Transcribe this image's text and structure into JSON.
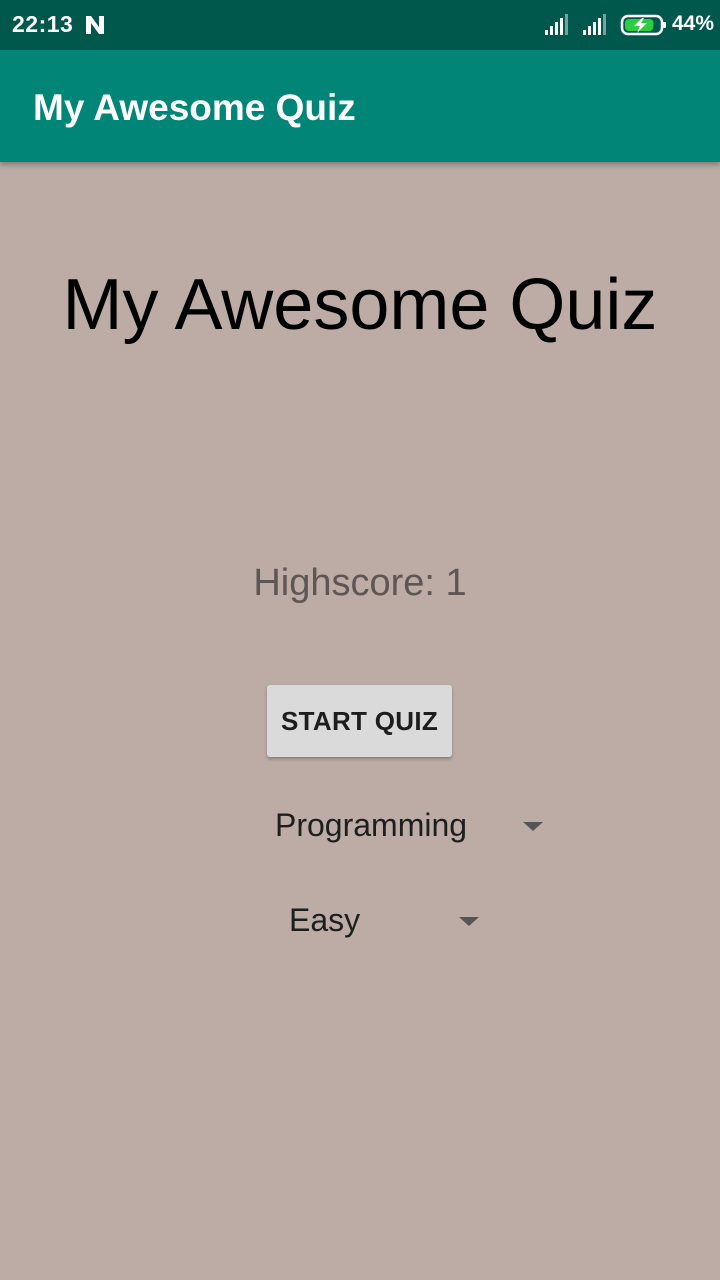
{
  "status_bar": {
    "time": "22:13",
    "battery_percent": "44%",
    "battery_level": 0.44,
    "charging": true,
    "icons": [
      "n-notification-icon",
      "signal-icon",
      "signal-icon",
      "battery-charging-icon"
    ]
  },
  "app_bar": {
    "title": "My Awesome Quiz",
    "color": "#008577"
  },
  "main": {
    "title": "My Awesome Quiz",
    "highscore": "Highscore: 1",
    "start_button_label": "START QUIZ",
    "category_spinner": {
      "selected": "Programming"
    },
    "difficulty_spinner": {
      "selected": "Easy"
    }
  },
  "colors": {
    "status_bar": "#00584c",
    "app_bar": "#008577",
    "background": "#bcaca5",
    "button": "#dadada"
  }
}
